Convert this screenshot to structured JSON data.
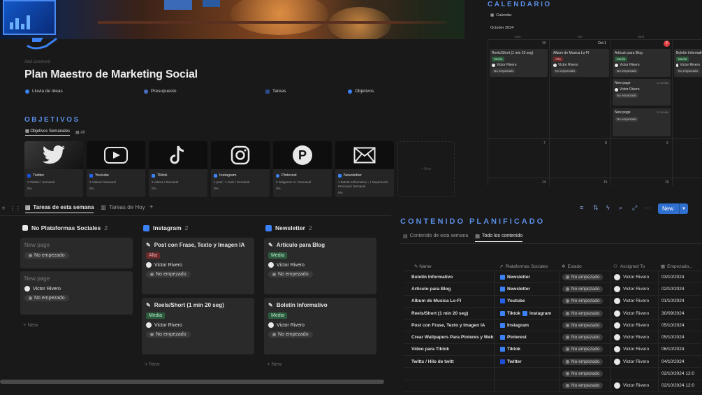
{
  "page": {
    "add_comment": "Add comment",
    "title": "Plan Maestro de Marketing Social",
    "nav": [
      {
        "label": "Lluvia de Ideas",
        "color": "#3b82f6"
      },
      {
        "label": "Presupuesto",
        "color": "#4b6fc4"
      },
      {
        "label": "Tareas",
        "color": "#2a4a8a"
      },
      {
        "label": "Objetivos",
        "color": "#3b82f6"
      }
    ]
  },
  "objetivos": {
    "heading": "OBJETIVOS",
    "tabs": [
      "Objetivos Semanales",
      "All"
    ],
    "cards": [
      {
        "name": "Twitter",
        "sub": "2 Twittes / Semanal",
        "pct": "0%",
        "icon": "twitter-bird-icon",
        "color": "#1d4ed8"
      },
      {
        "name": "Youtube",
        "sub": "2 Videos/ Semanal",
        "pct": "0%",
        "icon": "youtube-play-icon",
        "color": "#2563eb"
      },
      {
        "name": "Tiktok",
        "sub": "2 videos / Semanal",
        "pct": "0%",
        "icon": "tiktok-note-icon",
        "color": "#3b82f6"
      },
      {
        "name": "Instagram",
        "sub": "1 post ; 1 reels / Semanal",
        "pct": "0%",
        "icon": "instagram-camera-icon",
        "color": "#3b82f6"
      },
      {
        "name": "Pinterest",
        "sub": "3 imágenes AI / Semanal",
        "pct": "0%",
        "icon": "pinterest-p-icon",
        "color": "#3b82f6"
      },
      {
        "name": "Newsletter",
        "sub": "1 Boletín Informativo ; 1 Superación Personal / Semanal",
        "pct": "0%",
        "icon": "envelope-icon",
        "color": "#3b82f6"
      }
    ],
    "new_label": "+ New"
  },
  "calendar": {
    "heading": "CALENDARIO",
    "view": "Calendar",
    "month": "October 2024",
    "weekdays": [
      "Mon",
      "Tue",
      "Wed"
    ],
    "days_row1": [
      "30",
      "Oct 1",
      "2",
      ""
    ],
    "days_row2": [
      "7",
      "8",
      "9"
    ],
    "days_row3": [
      "14",
      "15",
      "16"
    ],
    "cards": [
      {
        "title": "Reels/Short (1 min 20 seg)",
        "tag": "Media",
        "tag_type": "media",
        "person": "Victor Rivero",
        "status": "No empezado"
      },
      {
        "title": "Album de Musica Lo-FI",
        "tag": "Alta",
        "tag_type": "alta",
        "person": "Victor Rivero",
        "status": "No empezado"
      },
      {
        "title": "Artículo para Blog",
        "tag": "Media",
        "tag_type": "media",
        "person": "Victor Rivero",
        "status": "No empezado"
      },
      {
        "title": "Boletín Informativo",
        "tag": "Media",
        "tag_type": "media",
        "person": "Victor Rivero",
        "status": "No empezado"
      },
      {
        "title": "New page",
        "time": "12:00 AM",
        "person": "Victor Rivero",
        "status": "No empezado"
      },
      {
        "title": "New page",
        "time": "12:00 AM",
        "status": "No empezado"
      }
    ]
  },
  "board": {
    "tabs": [
      "Tareas de esta semana",
      "Tareas de Hoy"
    ],
    "columns": [
      {
        "title": "No Plataformas Sociales",
        "count": "2",
        "cards": [
          {
            "title": "New page",
            "status": "No empezado"
          },
          {
            "title": "New page",
            "person": "Victor Rivero",
            "status": "No empezado"
          }
        ]
      },
      {
        "title": "Instagram",
        "count": "2",
        "cards": [
          {
            "title": "Post con Frase, Texto y Imagen IA",
            "tag": "Alta",
            "person": "Victor Rivero",
            "status": "No empezado"
          },
          {
            "title": "Reels/Short (1 min 20 seg)",
            "tag": "Media",
            "person": "Victor Rivero",
            "status": "No empezado"
          }
        ]
      },
      {
        "title": "Newsletter",
        "count": "2",
        "cards": [
          {
            "title": "Artículo para Blog",
            "tag": "Media",
            "person": "Victor Rivero",
            "status": "No empezado"
          },
          {
            "title": "Boletín Informativo",
            "tag": "Media",
            "person": "Victor Rivero",
            "status": "No empezado"
          }
        ]
      }
    ],
    "new_label": "New"
  },
  "contenido": {
    "heading": "CONTENIDO PLANIFICADO",
    "tabs": [
      "Contenido de esta semana",
      "Todo los contenido"
    ],
    "new_button": "New",
    "columns": [
      "Name",
      "Plataformas Sociales",
      "Estado",
      "Assigned To",
      "Empezado..."
    ],
    "rows": [
      {
        "name": "Boletín Informativo",
        "platforms": [
          "Newsletter"
        ],
        "estado": "No empezado",
        "assigned": "Victor Rivero",
        "date": "03/10/2024"
      },
      {
        "name": "Artículo para Blog",
        "platforms": [
          "Newsletter"
        ],
        "estado": "No empezado",
        "assigned": "Victor Rivero",
        "date": "02/10/2024"
      },
      {
        "name": "Album de Musica Lo-FI",
        "platforms": [
          "Youtube"
        ],
        "estado": "No empezado",
        "assigned": "Victor Rivero",
        "date": "01/10/2024"
      },
      {
        "name": "Reels/Short (1 min 20 seg)",
        "platforms": [
          "Tiktok",
          "Instagram"
        ],
        "estado": "No empezado",
        "assigned": "Victor Rivero",
        "date": "30/09/2024"
      },
      {
        "name": "Post con Frase, Texto y Imagen IA",
        "platforms": [
          "Instagram"
        ],
        "estado": "No empezado",
        "assigned": "Victor Rivero",
        "date": "05/10/2024"
      },
      {
        "name": "Crear Wallpapers Para Pinteres y Web",
        "platforms": [
          "Pinterest"
        ],
        "estado": "No empezado",
        "assigned": "Victor Rivero",
        "date": "05/10/2024"
      },
      {
        "name": "Video para Tiktok",
        "platforms": [
          "Tiktok"
        ],
        "estado": "No empezado",
        "assigned": "Victor Rivero",
        "date": "06/10/2024"
      },
      {
        "name": "Twitts / Hilo de twitt",
        "platforms": [
          "Twitter"
        ],
        "estado": "No empezado",
        "assigned": "Victor Rivero",
        "date": "04/10/2024"
      },
      {
        "name": "",
        "platforms": [],
        "estado": "No empezado",
        "assigned": "",
        "date": "02/10/2024 12:0"
      },
      {
        "name": "",
        "platforms": [],
        "estado": "No empezado",
        "assigned": "Victor Rivero",
        "date": "02/10/2024 12:0"
      }
    ]
  }
}
